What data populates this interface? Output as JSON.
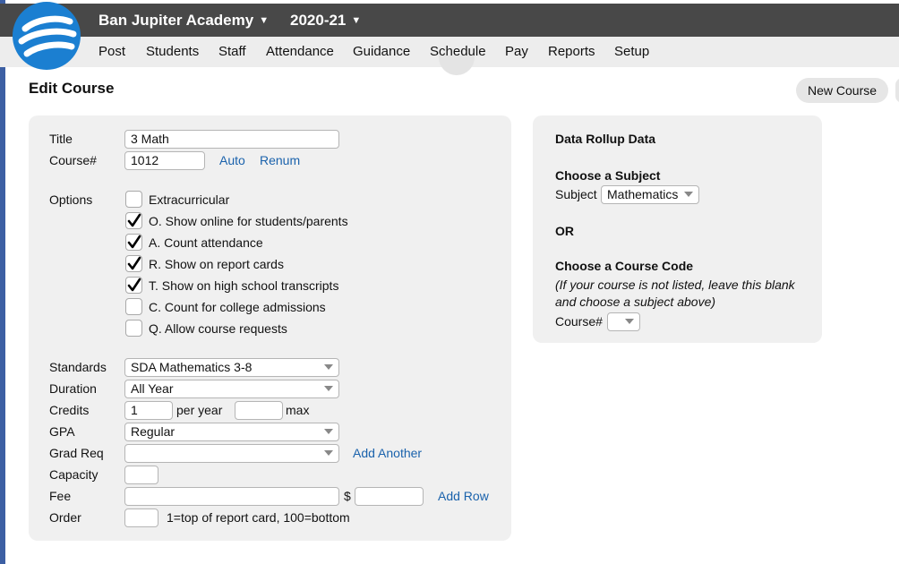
{
  "header": {
    "school": "Ban Jupiter Academy",
    "year": "2020-21",
    "nav": [
      "Post",
      "Students",
      "Staff",
      "Attendance",
      "Guidance",
      "Schedule",
      "Pay",
      "Reports",
      "Setup"
    ]
  },
  "page": {
    "title": "Edit Course",
    "new_course_label": "New Course"
  },
  "form": {
    "title_label": "Title",
    "title_value": "3 Math",
    "course_label": "Course#",
    "course_value": "1012",
    "auto_link": "Auto",
    "renum_link": "Renum",
    "options_label": "Options",
    "options": [
      {
        "label": "Extracurricular",
        "checked": false
      },
      {
        "label": "O. Show online for students/parents",
        "checked": true
      },
      {
        "label": "A. Count attendance",
        "checked": true
      },
      {
        "label": "R. Show on report cards",
        "checked": true
      },
      {
        "label": "T. Show on high school transcripts",
        "checked": true
      },
      {
        "label": "C. Count for college admissions",
        "checked": false
      },
      {
        "label": "Q. Allow course requests",
        "checked": false
      }
    ],
    "standards_label": "Standards",
    "standards_value": "SDA Mathematics 3-8",
    "duration_label": "Duration",
    "duration_value": "All Year",
    "credits_label": "Credits",
    "credits_value": "1",
    "per_year": "per year",
    "max_value": "",
    "max_label": "max",
    "gpa_label": "GPA",
    "gpa_value": "Regular",
    "gradreq_label": "Grad Req",
    "gradreq_value": "",
    "add_another": "Add Another",
    "capacity_label": "Capacity",
    "capacity_value": "",
    "fee_label": "Fee",
    "fee_value": "",
    "dollar": "$",
    "fee_amount": "",
    "add_row": "Add Row",
    "order_label": "Order",
    "order_value": "",
    "order_hint": "1=top of report card, 100=bottom"
  },
  "rollup": {
    "title": "Data Rollup Data",
    "subject_heading": "Choose a Subject",
    "subject_label": "Subject",
    "subject_value": "Mathematics",
    "or": "OR",
    "code_heading": "Choose a Course Code",
    "note_line1": "(If your course is not listed, leave this blank",
    "note_line2": "and choose a subject above)",
    "course_label": "Course#",
    "course_value": ""
  },
  "colors": {
    "topbar": "#484848",
    "navbar": "#ededed",
    "link": "#1a62ac",
    "logo": "#1b7fd1"
  }
}
